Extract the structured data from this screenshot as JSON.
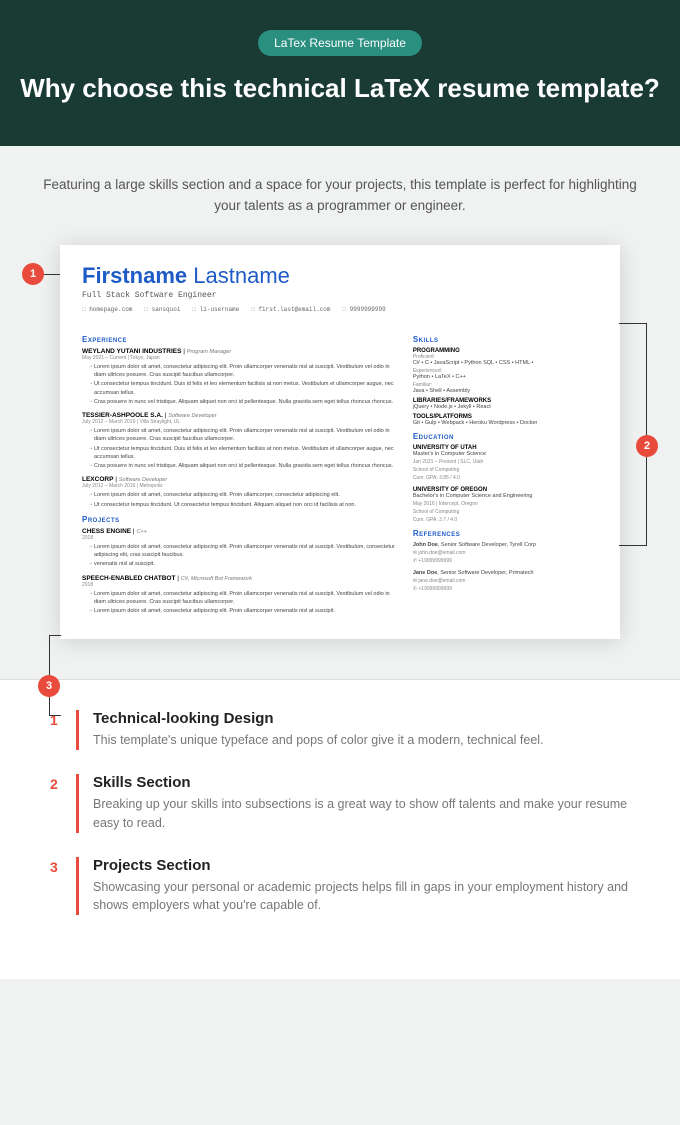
{
  "header": {
    "badge": "LaTex Resume Template",
    "title": "Why choose this technical LaTeX resume template?"
  },
  "intro": "Featuring a large skills section and a space for your projects, this template is perfect for highlighting your talents as a programmer or engineer.",
  "markers": {
    "m1": "1",
    "m2": "2",
    "m3": "3"
  },
  "resume": {
    "firstname": "Firstname",
    "lastname": "Lastname",
    "role": "Full Stack Software Engineer",
    "contacts": {
      "homepage": "homepage.com",
      "github": "sansquoi",
      "linkedin": "li-username",
      "email": "first.last@email.com",
      "phone": "9999999999"
    },
    "sections": {
      "experience": "Experience",
      "projects": "Projects",
      "skills": "Skills",
      "education": "Education",
      "references": "References"
    },
    "jobs": [
      {
        "company": "WEYLAND YUTANI INDUSTRIES",
        "title": "Program Manager",
        "meta": "May 2021 – Current | Tokyo, Japan",
        "bullets": [
          "Lorem ipsum dolor sit amet, consectetur adipiscing elit. Proin ullamcorper venenatis nisl at suscipit. Vestibulum vel odio in diam ultrices posuere. Cras suscipit faucibus ullamcorper.",
          "Ut consectetur tempus tincidunt. Duis id felis et leo elementum facilisis at non metus. Vestibulum et ullamcorper augue, nec accumsan tellus.",
          "Cras posuere in nunc vel tristique. Aliquam aliquet non orci id pellentesque. Nulla gravida sem eget tellus rhoncus rhoncus."
        ]
      },
      {
        "company": "TESSIER-ASHPOOLE S.A.",
        "title": "Software Developer",
        "meta": "July 2012 – March 2019 | Villa Straylight, UL",
        "bullets": [
          "Lorem ipsum dolor sit amet, consectetur adipiscing elit. Proin ullamcorper venenatis nisl at suscipit. Vestibulum vel odio in diam ultrices posuere. Cras suscipit faucibus ullamcorper.",
          "Ut consectetur tempus tincidunt. Duis id felis et leo elementum facilisis at non metus. Vestibulum et ullamcorper augue, nec accumsan tellus.",
          "Cras posuere in nunc vel tristique. Aliquam aliquet non orci id pellentesque. Nulla gravida sem eget tellus rhoncus rhoncus."
        ]
      },
      {
        "company": "LEXCORP",
        "title": "Software Developer",
        "meta": "July 2012 – March 2016 | Metropolis",
        "bullets": [
          "Lorem ipsum dolor sit amet, consectetur adipiscing elit. Proin ullamcorper, consectetur adipiscing elit.",
          "Ut consectetur tempus tincidunt. Ut consectetur tempus tincidunt. Aliquam aliquet non orci id facilisis at non."
        ]
      }
    ],
    "projects": [
      {
        "name": "CHESS ENGINE",
        "tech": "C++",
        "year": "2018",
        "bullets": [
          "Lorem ipsum dolor sit amet, consectetur adipiscing elit. Proin ullamcorper venenatis nisl at suscipit. Vestibulum, consectetur adipiscing elit, cras suscipit faucibus.",
          "venenatis nisl at suscipit."
        ]
      },
      {
        "name": "SPEECH-ENABLED CHATBOT",
        "tech": "C#, Microsoft Bot Framework",
        "year": "2018",
        "bullets": [
          "Lorem ipsum dolor sit amet, consectetur adipiscing elit. Proin ullamcorper venenatis nisl at suscipit. Vestibulum vel odio in diam ultrices posuere. Cras suscipit faucibus ullamcorper.",
          "Lorem ipsum dolor sit amet, consectetur adipiscing elit. Proin ullamcorper venenatis nisl at suscipit."
        ]
      }
    ],
    "skills": {
      "programming": "PROGRAMMING",
      "proficient_label": "Proficient:",
      "proficient": "C# • C • JavaScript • Python SQL • CSS • HTML •",
      "experienced_label": "Experienced:",
      "experienced": "Python • LaTeX • C++",
      "familiar_label": "Familiar:",
      "familiar": "Java • Shell • Assembly",
      "libraries_h": "LIBRARIES/FRAMEWORKS",
      "libraries": "jQuery • Node.js • Jekyll • React",
      "tools_h": "TOOLS/PLATFORMS",
      "tools": "Git • Gulp • Webpack • Heroku Wordpress • Docker"
    },
    "education": [
      {
        "school": "UNIVERSITY OF UTAH",
        "degree": "Master's in Computer Science",
        "meta": "Jan 2021 – Present | SLC, Utah",
        "dept": "School of Computing",
        "gpa": "Cum. GPA: 3.85 / 4.0"
      },
      {
        "school": "UNIVERSITY OF OREGON",
        "degree": "Bachelor's in Computer Science and Engineering",
        "meta": "May 2016 | Intercept, Oregon",
        "dept": "School of Computing",
        "gpa": "Cum. GPA: 3.7 / 4.0"
      }
    ],
    "references": [
      {
        "name": "John Doe",
        "title": "Senior Software Developer, Tyrell Corp",
        "email": "john.doe@email.com",
        "phone": "+19999999999"
      },
      {
        "name": "Jane Doe",
        "title": "Senior Software Developer, Primatech",
        "email": "jane.doe@email.com",
        "phone": "+19999999999"
      }
    ]
  },
  "features": [
    {
      "num": "1",
      "title": "Technical-looking Design",
      "desc": "This template's unique typeface and pops of color give it a modern, technical feel."
    },
    {
      "num": "2",
      "title": "Skills Section",
      "desc": "Breaking up your skills into subsections is a great way to show off talents and make your resume easy to read."
    },
    {
      "num": "3",
      "title": "Projects Section",
      "desc": "Showcasing your personal or academic projects helps fill in gaps in your employment history and shows employers what you're capable of."
    }
  ]
}
